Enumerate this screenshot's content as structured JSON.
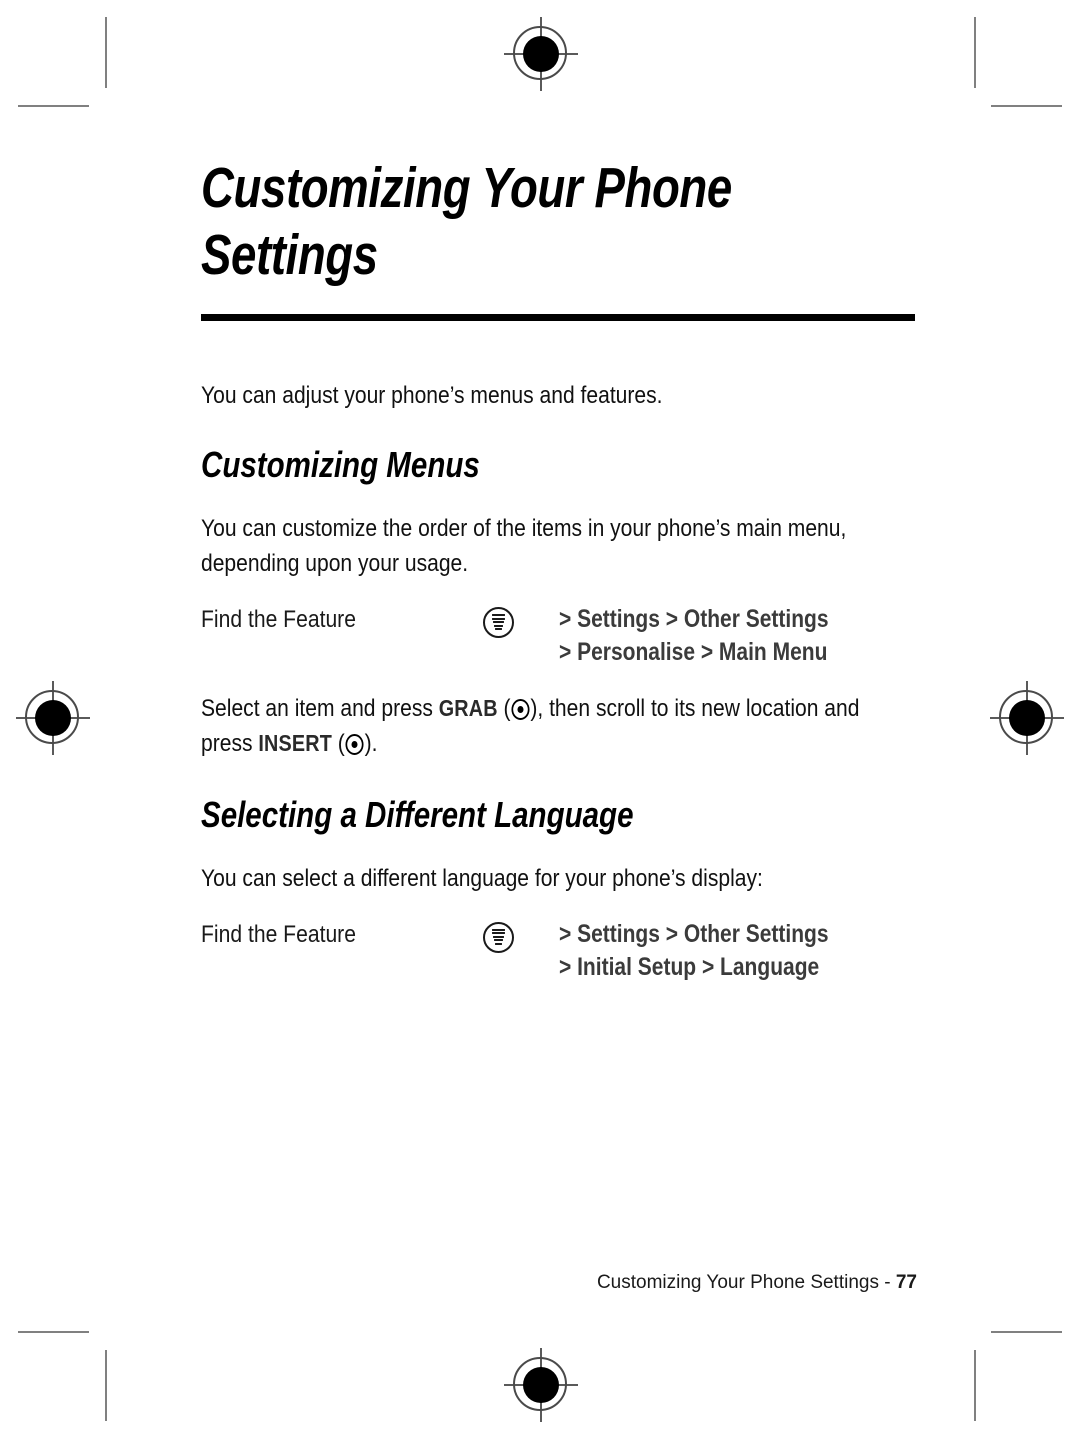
{
  "page": {
    "title_line1": "Customizing Your Phone",
    "title_line2": "Settings",
    "intro": "You can adjust your phone’s menus and features."
  },
  "sections": [
    {
      "heading": "Customizing Menus",
      "paragraph": "You can customize the order of the items in your phone’s main menu, depending upon your usage.",
      "find_the_feature": {
        "label": "Find the Feature",
        "icon": "menu-icon",
        "path_line1": "> Settings > Other Settings",
        "path_line2": "> Personalise > Main Menu"
      },
      "instruction": {
        "part1": "Select an item and press ",
        "key1": "GRAB",
        "part2": ", then scroll to its new location and press ",
        "key2": "INSERT",
        "part3": "."
      }
    },
    {
      "heading": "Selecting a Different Language",
      "paragraph": "You can select a different language for your phone’s display:",
      "find_the_feature": {
        "label": "Find the Feature",
        "icon": "menu-icon",
        "path_line1": "> Settings > Other Settings",
        "path_line2": "> Initial Setup > Language"
      }
    }
  ],
  "footer": {
    "text": "Customizing Your Phone Settings - ",
    "page_number": "77"
  },
  "colors": {
    "text": "#1a1a1a",
    "path_text": "#3b3b3b",
    "rule": "#000000",
    "crop_mark": "#808080",
    "registration_mark": "#4a4a4a"
  }
}
